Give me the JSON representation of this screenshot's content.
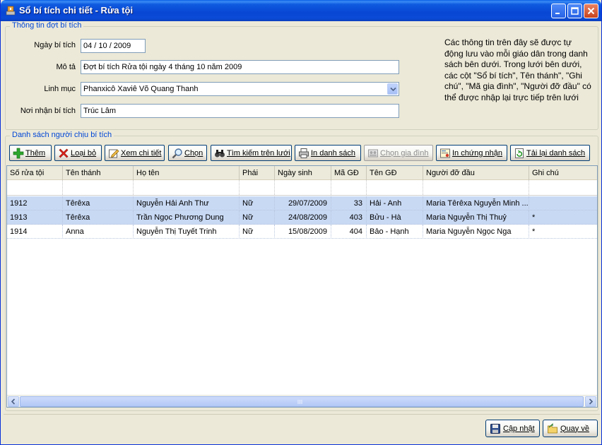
{
  "window": {
    "title": "Sổ bí tích chi tiết - Rửa tội"
  },
  "info_group": {
    "legend": "Thông tin đợt bí tích",
    "date_label": "Ngày bí tích",
    "date_value": "04  /  10  / 2009",
    "desc_label": "Mô tả",
    "desc_value": "Đợt bí tích Rửa tội ngày 4 tháng 10 năm 2009",
    "priest_label": "Linh mục",
    "priest_value": "Phanxicô Xaviê Võ Quang Thanh",
    "place_label": "Nơi nhận bí tích",
    "place_value": "Trúc Lâm",
    "note": "Các thông tin trên đây sẽ được tự động lưu vào mỗi giáo dân trong danh sách bên dưới. Trong lưới bên dưới, các cột \"Sổ bí tích\", Tên thánh\", \"Ghi chú\", \"Mã gia đình\", \"Người đỡ đầu\" có thể được nhập lại trực tiếp trên lưới"
  },
  "list_group": {
    "legend": "Danh sách người chịu bí tích"
  },
  "toolbar": {
    "add": "Thêm",
    "remove": "Loại bỏ",
    "view": "Xem chi tiết",
    "choose": "Chọn",
    "search": "Tìm kiếm trên lưới",
    "print_list": "In danh sách",
    "choose_family": "Chọn gia đình",
    "print_cert": "In chứng nhận",
    "reload": "Tải lại danh sách"
  },
  "grid": {
    "columns": [
      "Số rửa tội",
      "Tên thánh",
      "Họ tên",
      "Phái",
      "Ngày sinh",
      "Mã GĐ",
      "Tên GĐ",
      "Người đỡ đầu",
      "Ghi chú"
    ],
    "rows": [
      [
        "1912",
        "Têrêxa",
        "Nguyễn Hải Anh Thư",
        "Nữ",
        "29/07/2009",
        "33",
        "Hải - Anh",
        "Maria Têrêxa Nguyễn Minh ...",
        ""
      ],
      [
        "1913",
        "Têrêxa",
        "Trần Ngọc Phương Dung",
        "Nữ",
        "24/08/2009",
        "403",
        "Bửu - Hà",
        "Maria Nguyễn Thị Thuỷ",
        "*"
      ],
      [
        "1914",
        "Anna",
        "Nguyễn Thị Tuyết Trinh",
        "Nữ",
        "15/08/2009",
        "404",
        "Bảo - Hạnh",
        "Maria Nguyễn Ngọc Nga",
        "*"
      ]
    ]
  },
  "buttons": {
    "update": "Cập nhật",
    "back": "Quay về"
  },
  "colors": {
    "accent": "#0046d5",
    "selected_row": "#c8d9f4",
    "titlebar": "#0846d4"
  }
}
